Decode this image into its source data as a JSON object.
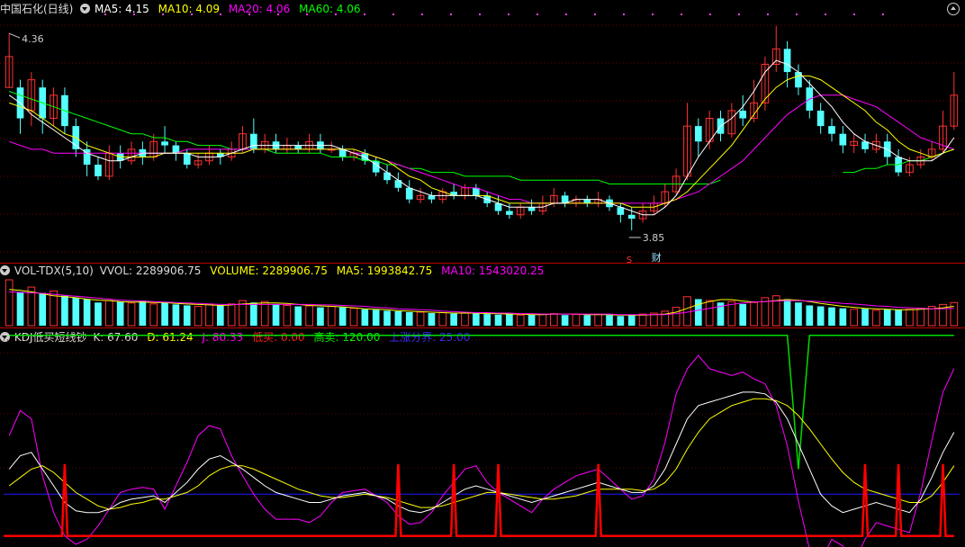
{
  "header": {
    "stock": "中国石化(日线)",
    "ma5_label": "MA5: 4.15",
    "ma10_label": "MA10: 4.09",
    "ma20_label": "MA20: 4.06",
    "ma60_label": "MA60: 4.06"
  },
  "vol_header": {
    "name": "VOL-TDX(5,10)",
    "vvol": "VVOL: 2289906.75",
    "volume": "VOLUME: 2289906.75",
    "ma5": "MA5: 1993842.75",
    "ma10": "MA10: 1543020.25"
  },
  "kdj_header": {
    "name": "KDJ低买短线钞",
    "k": "K: 67.60",
    "d": "D: 61.24",
    "j": "J: 80.33",
    "low": "低买: 0.00",
    "high": "高卖: 120.00",
    "rise": "上涨分界: 25.00"
  },
  "annotations": {
    "high": "4.36",
    "low": "3.85",
    "mark_s": "S",
    "mark_cai": "财"
  },
  "colors": {
    "up": "#ff3232",
    "down": "#54ffff",
    "ma5": "#ffffff",
    "ma10": "#ffff00",
    "ma20": "#ff00ff",
    "ma60": "#00ff00",
    "red_line": "#ff0000",
    "green_line": "#00dd00",
    "blue_line": "#1a1aff"
  },
  "chart_data": {
    "type": "candlestick",
    "price_range": [
      3.78,
      4.4
    ],
    "candles": [
      [
        4.22,
        4.3,
        4.22,
        4.36
      ],
      [
        4.22,
        4.14,
        4.1,
        4.24
      ],
      [
        4.16,
        4.24,
        4.12,
        4.26
      ],
      [
        4.22,
        4.14,
        4.1,
        4.24
      ],
      [
        4.14,
        4.2,
        4.12,
        4.22
      ],
      [
        4.2,
        4.12,
        4.1,
        4.22
      ],
      [
        4.12,
        4.06,
        4.04,
        4.14
      ],
      [
        4.06,
        4.02,
        3.99,
        4.08
      ],
      [
        4.02,
        3.99,
        3.98,
        4.04
      ],
      [
        3.99,
        4.05,
        3.98,
        4.07
      ],
      [
        4.05,
        4.03,
        4.01,
        4.07
      ],
      [
        4.03,
        4.06,
        4.02,
        4.08
      ],
      [
        4.06,
        4.04,
        4.02,
        4.08
      ],
      [
        4.04,
        4.08,
        4.03,
        4.1
      ],
      [
        4.08,
        4.07,
        4.05,
        4.12
      ],
      [
        4.07,
        4.05,
        4.03,
        4.08
      ],
      [
        4.05,
        4.02,
        4.01,
        4.06
      ],
      [
        4.02,
        4.03,
        4.01,
        4.05
      ],
      [
        4.03,
        4.05,
        4.02,
        4.07
      ],
      [
        4.05,
        4.04,
        4.02,
        4.06
      ],
      [
        4.04,
        4.06,
        4.03,
        4.08
      ],
      [
        4.06,
        4.1,
        4.05,
        4.12
      ],
      [
        4.1,
        4.06,
        4.05,
        4.14
      ],
      [
        4.06,
        4.08,
        4.05,
        4.1
      ],
      [
        4.08,
        4.06,
        4.05,
        4.1
      ],
      [
        4.06,
        4.07,
        4.05,
        4.09
      ],
      [
        4.07,
        4.06,
        4.05,
        4.08
      ],
      [
        4.06,
        4.08,
        4.05,
        4.1
      ],
      [
        4.08,
        4.06,
        4.05,
        4.1
      ],
      [
        4.06,
        4.06,
        4.05,
        4.08
      ],
      [
        4.06,
        4.04,
        4.03,
        4.07
      ],
      [
        4.04,
        4.05,
        4.03,
        4.06
      ],
      [
        4.05,
        4.03,
        4.02,
        4.06
      ],
      [
        4.03,
        4.0,
        3.99,
        4.04
      ],
      [
        4.0,
        3.98,
        3.97,
        4.02
      ],
      [
        3.98,
        3.96,
        3.95,
        4.0
      ],
      [
        3.96,
        3.93,
        3.92,
        3.98
      ],
      [
        3.93,
        3.94,
        3.92,
        3.96
      ],
      [
        3.94,
        3.93,
        3.92,
        3.95
      ],
      [
        3.93,
        3.95,
        3.92,
        3.96
      ],
      [
        3.95,
        3.94,
        3.93,
        3.97
      ],
      [
        3.94,
        3.96,
        3.93,
        3.97
      ],
      [
        3.96,
        3.94,
        3.93,
        3.97
      ],
      [
        3.94,
        3.92,
        3.91,
        3.95
      ],
      [
        3.92,
        3.9,
        3.89,
        3.94
      ],
      [
        3.9,
        3.89,
        3.88,
        3.92
      ],
      [
        3.89,
        3.91,
        3.88,
        3.92
      ],
      [
        3.91,
        3.9,
        3.89,
        3.93
      ],
      [
        3.9,
        3.92,
        3.89,
        3.94
      ],
      [
        3.92,
        3.94,
        3.91,
        3.96
      ],
      [
        3.94,
        3.92,
        3.91,
        3.95
      ],
      [
        3.92,
        3.93,
        3.91,
        3.94
      ],
      [
        3.93,
        3.92,
        3.91,
        3.94
      ],
      [
        3.92,
        3.93,
        3.91,
        3.95
      ],
      [
        3.93,
        3.91,
        3.9,
        3.94
      ],
      [
        3.91,
        3.89,
        3.87,
        3.92
      ],
      [
        3.89,
        3.88,
        3.85,
        3.91
      ],
      [
        3.88,
        3.9,
        3.87,
        3.92
      ],
      [
        3.9,
        3.92,
        3.89,
        3.94
      ],
      [
        3.92,
        3.95,
        3.91,
        3.97
      ],
      [
        3.95,
        3.99,
        3.94,
        4.01
      ],
      [
        3.99,
        4.12,
        3.98,
        4.18
      ],
      [
        4.12,
        4.08,
        4.04,
        4.14
      ],
      [
        4.08,
        4.14,
        4.06,
        4.16
      ],
      [
        4.14,
        4.1,
        4.08,
        4.16
      ],
      [
        4.1,
        4.16,
        4.09,
        4.18
      ],
      [
        4.16,
        4.14,
        4.12,
        4.2
      ],
      [
        4.14,
        4.18,
        4.13,
        4.24
      ],
      [
        4.18,
        4.28,
        4.16,
        4.3
      ],
      [
        4.28,
        4.32,
        4.26,
        4.38
      ],
      [
        4.32,
        4.26,
        4.22,
        4.34
      ],
      [
        4.26,
        4.22,
        4.2,
        4.28
      ],
      [
        4.22,
        4.16,
        4.14,
        4.24
      ],
      [
        4.16,
        4.12,
        4.1,
        4.18
      ],
      [
        4.12,
        4.1,
        4.08,
        4.14
      ],
      [
        4.1,
        4.07,
        4.05,
        4.12
      ],
      [
        4.07,
        4.08,
        4.05,
        4.1
      ],
      [
        4.08,
        4.06,
        4.05,
        4.1
      ],
      [
        4.06,
        4.08,
        4.05,
        4.1
      ],
      [
        4.08,
        4.04,
        4.02,
        4.1
      ],
      [
        4.04,
        4.0,
        3.99,
        4.06
      ],
      [
        4.0,
        4.02,
        3.99,
        4.04
      ],
      [
        4.02,
        4.04,
        4.01,
        4.06
      ],
      [
        4.04,
        4.06,
        4.03,
        4.08
      ],
      [
        4.06,
        4.12,
        4.05,
        4.16
      ],
      [
        4.12,
        4.2,
        4.11,
        4.26
      ]
    ],
    "ma5": [
      4.2,
      4.18,
      4.15,
      4.13,
      4.11,
      4.09,
      4.07,
      4.05,
      4.04,
      4.03,
      4.03,
      4.04,
      4.05,
      4.05,
      4.05,
      4.05,
      4.05,
      4.04,
      4.04,
      4.04,
      4.05,
      4.06,
      4.07,
      4.07,
      4.07,
      4.07,
      4.07,
      4.07,
      4.07,
      4.07,
      4.06,
      4.05,
      4.04,
      4.02,
      4.0,
      3.98,
      3.96,
      3.95,
      3.94,
      3.94,
      3.94,
      3.94,
      3.94,
      3.93,
      3.92,
      3.91,
      3.91,
      3.91,
      3.91,
      3.92,
      3.92,
      3.93,
      3.93,
      3.93,
      3.92,
      3.91,
      3.9,
      3.89,
      3.89,
      3.91,
      3.94,
      3.99,
      4.04,
      4.08,
      4.12,
      4.14,
      4.17,
      4.21,
      4.26,
      4.29,
      4.28,
      4.26,
      4.23,
      4.2,
      4.17,
      4.13,
      4.1,
      4.08,
      4.07,
      4.06,
      4.04,
      4.03,
      4.03,
      4.03,
      4.05,
      4.09
    ],
    "ma10": [
      4.18,
      4.17,
      4.16,
      4.14,
      4.12,
      4.1,
      4.09,
      4.07,
      4.06,
      4.05,
      4.04,
      4.04,
      4.04,
      4.04,
      4.05,
      4.05,
      4.05,
      4.05,
      4.05,
      4.05,
      4.05,
      4.05,
      4.06,
      4.06,
      4.06,
      4.06,
      4.06,
      4.06,
      4.06,
      4.06,
      4.06,
      4.06,
      4.05,
      4.04,
      4.03,
      4.01,
      3.99,
      3.98,
      3.96,
      3.95,
      3.94,
      3.94,
      3.94,
      3.94,
      3.93,
      3.92,
      3.92,
      3.92,
      3.92,
      3.92,
      3.92,
      3.92,
      3.92,
      3.92,
      3.92,
      3.92,
      3.91,
      3.91,
      3.91,
      3.92,
      3.93,
      3.95,
      3.98,
      4.01,
      4.04,
      4.07,
      4.11,
      4.15,
      4.19,
      4.22,
      4.24,
      4.25,
      4.25,
      4.24,
      4.22,
      4.2,
      4.18,
      4.16,
      4.13,
      4.11,
      4.08,
      4.06,
      4.05,
      4.04,
      4.05,
      4.06
    ],
    "ma20": [
      4.08,
      4.07,
      4.06,
      4.06,
      4.05,
      4.05,
      4.05,
      4.05,
      4.05,
      4.05,
      4.05,
      4.05,
      4.05,
      4.05,
      4.05,
      4.05,
      4.06,
      4.06,
      4.06,
      4.06,
      4.06,
      4.06,
      4.06,
      4.06,
      4.06,
      4.06,
      4.06,
      4.06,
      4.06,
      4.06,
      4.06,
      4.05,
      4.05,
      4.04,
      4.03,
      4.02,
      4.01,
      4.0,
      3.99,
      3.98,
      3.97,
      3.96,
      3.96,
      3.95,
      3.94,
      3.93,
      3.93,
      3.92,
      3.92,
      3.92,
      3.92,
      3.92,
      3.92,
      3.92,
      3.92,
      3.92,
      3.92,
      3.92,
      3.92,
      3.92,
      3.93,
      3.94,
      3.95,
      3.97,
      3.99,
      4.01,
      4.03,
      4.06,
      4.09,
      4.12,
      4.15,
      4.17,
      4.19,
      4.2,
      4.2,
      4.2,
      4.19,
      4.18,
      4.17,
      4.15,
      4.13,
      4.11,
      4.09,
      4.08,
      4.07,
      4.06
    ],
    "ma60": [
      4.21,
      4.2,
      4.19,
      4.18,
      4.17,
      4.16,
      4.15,
      4.14,
      4.13,
      4.12,
      4.11,
      4.1,
      4.1,
      4.09,
      4.09,
      4.08,
      4.08,
      4.07,
      4.07,
      4.07,
      4.06,
      4.06,
      4.06,
      4.06,
      4.05,
      4.05,
      4.05,
      4.05,
      4.05,
      4.04,
      4.04,
      4.04,
      4.03,
      4.03,
      4.02,
      4.02,
      4.01,
      4.01,
      4.0,
      4.0,
      4.0,
      3.99,
      3.99,
      3.99,
      3.99,
      3.99,
      3.98,
      3.98,
      3.98,
      3.98,
      3.98,
      3.98,
      3.98,
      3.98,
      3.97,
      3.97,
      3.97,
      3.97,
      3.97,
      3.97,
      3.97,
      3.97,
      3.97,
      3.97,
      3.98,
      null,
      null,
      null,
      null,
      null,
      null,
      null,
      null,
      null,
      null,
      4.0,
      4.0,
      4.01,
      4.01,
      4.02,
      4.02,
      4.03,
      4.03,
      4.04,
      4.05,
      4.06
    ],
    "volume": [
      95,
      70,
      80,
      68,
      72,
      62,
      58,
      55,
      48,
      52,
      50,
      47,
      52,
      45,
      48,
      44,
      42,
      40,
      45,
      43,
      45,
      52,
      48,
      50,
      44,
      42,
      40,
      41,
      38,
      40,
      38,
      36,
      34,
      33,
      31,
      30,
      28,
      28,
      26,
      27,
      25,
      26,
      25,
      24,
      23,
      24,
      22,
      23,
      24,
      25,
      22,
      23,
      22,
      24,
      22,
      20,
      22,
      24,
      26,
      30,
      38,
      60,
      55,
      52,
      48,
      50,
      45,
      48,
      58,
      62,
      55,
      48,
      42,
      40,
      38,
      36,
      34,
      35,
      32,
      34,
      33,
      34,
      36,
      40,
      44,
      48
    ],
    "vol_ma5": [
      75,
      73,
      70,
      66,
      62,
      60,
      58,
      55,
      53,
      52,
      50,
      49,
      49,
      48,
      48,
      46,
      45,
      44,
      43,
      42,
      43,
      45,
      46,
      47,
      47,
      46,
      44,
      42,
      41,
      40,
      39,
      37,
      35,
      34,
      33,
      31,
      30,
      29,
      28,
      27,
      26,
      26,
      26,
      25,
      25,
      24,
      24,
      23,
      23,
      24,
      24,
      24,
      23,
      23,
      23,
      22,
      22,
      22,
      23,
      24,
      28,
      36,
      44,
      50,
      54,
      54,
      51,
      49,
      50,
      52,
      54,
      53,
      50,
      46,
      43,
      40,
      38,
      36,
      35,
      34,
      33,
      33,
      34,
      35,
      37,
      40
    ],
    "vol_ma10": [
      70,
      69,
      68,
      67,
      65,
      63,
      61,
      59,
      57,
      55,
      53,
      52,
      51,
      50,
      49,
      48,
      47,
      46,
      45,
      44,
      44,
      44,
      44,
      44,
      44,
      44,
      44,
      44,
      43,
      43,
      42,
      41,
      40,
      38,
      37,
      35,
      34,
      33,
      32,
      30,
      29,
      28,
      27,
      27,
      26,
      26,
      25,
      25,
      24,
      24,
      24,
      24,
      24,
      24,
      24,
      23,
      23,
      23,
      23,
      23,
      25,
      28,
      32,
      36,
      40,
      44,
      47,
      49,
      50,
      51,
      52,
      52,
      51,
      50,
      48,
      46,
      45,
      43,
      41,
      40,
      38,
      37,
      36,
      35,
      35,
      36
    ],
    "kdj_range": [
      -5,
      115
    ],
    "K": [
      40,
      48,
      50,
      40,
      30,
      20,
      15,
      14,
      14,
      16,
      20,
      22,
      23,
      24,
      20,
      26,
      32,
      40,
      46,
      48,
      44,
      40,
      35,
      30,
      26,
      24,
      22,
      20,
      20,
      22,
      24,
      25,
      26,
      24,
      22,
      18,
      15,
      14,
      16,
      20,
      24,
      28,
      30,
      28,
      26,
      24,
      22,
      20,
      22,
      24,
      26,
      28,
      30,
      32,
      30,
      28,
      26,
      26,
      30,
      40,
      55,
      70,
      78,
      80,
      82,
      84,
      86,
      86,
      85,
      80,
      70,
      55,
      40,
      25,
      18,
      14,
      16,
      18,
      20,
      18,
      16,
      14,
      22,
      35,
      50,
      62
    ],
    "D": [
      30,
      35,
      40,
      42,
      38,
      32,
      26,
      22,
      18,
      16,
      17,
      19,
      20,
      22,
      22,
      24,
      26,
      30,
      36,
      40,
      42,
      42,
      40,
      37,
      34,
      31,
      28,
      26,
      24,
      23,
      23,
      24,
      25,
      24,
      23,
      21,
      19,
      17,
      17,
      18,
      20,
      22,
      24,
      26,
      26,
      25,
      24,
      23,
      22,
      22,
      23,
      24,
      26,
      28,
      28,
      28,
      28,
      27,
      28,
      32,
      40,
      52,
      62,
      70,
      74,
      78,
      80,
      82,
      82,
      81,
      78,
      72,
      64,
      55,
      46,
      38,
      32,
      28,
      26,
      24,
      22,
      20,
      20,
      24,
      32,
      42
    ],
    "J": [
      60,
      75,
      70,
      36,
      14,
      0,
      -5,
      -2,
      6,
      16,
      26,
      28,
      29,
      28,
      16,
      30,
      44,
      60,
      66,
      64,
      48,
      36,
      25,
      16,
      10,
      10,
      10,
      8,
      12,
      20,
      26,
      27,
      28,
      24,
      20,
      12,
      7,
      8,
      14,
      24,
      32,
      40,
      42,
      32,
      26,
      22,
      18,
      14,
      22,
      28,
      32,
      36,
      38,
      40,
      34,
      28,
      22,
      24,
      34,
      56,
      85,
      100,
      108,
      100,
      98,
      96,
      98,
      94,
      91,
      78,
      54,
      21,
      -8,
      -15,
      -2,
      -6,
      -16,
      -2,
      8,
      6,
      4,
      2,
      26,
      57,
      86,
      100
    ],
    "low_buy": [
      0,
      0,
      0,
      0,
      0,
      0,
      0,
      0,
      0,
      0,
      0,
      0,
      0,
      0,
      0,
      0,
      0,
      0,
      0,
      0,
      0,
      0,
      0,
      0,
      0,
      0,
      0,
      0,
      0,
      0,
      0,
      0,
      0,
      0,
      0,
      0,
      0,
      0,
      0,
      0,
      0,
      0,
      0,
      0,
      0,
      0,
      0,
      0,
      0,
      0,
      0,
      0,
      0,
      0,
      0,
      0,
      0,
      0,
      0,
      0,
      0,
      0,
      0,
      0,
      0,
      0,
      0,
      0,
      0,
      0,
      0,
      0,
      0,
      0,
      0,
      0,
      0,
      0,
      0,
      0,
      0,
      0,
      0,
      0,
      0,
      0
    ],
    "high_sell": 120,
    "rise_line": 25
  }
}
